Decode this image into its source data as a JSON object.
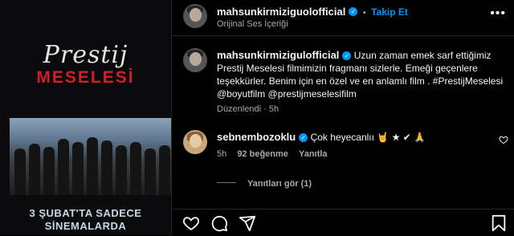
{
  "poster": {
    "title_line1": "Prestij",
    "title_line2": "MESELESİ",
    "release_line1": "3 ŞUBAT'TA SADECE",
    "release_line2": "SİNEMALARDA"
  },
  "header": {
    "username": "mahsunkirmiziguolofficial",
    "separator": "•",
    "follow_label": "Takip Et",
    "audio_label": "Orijinal Ses İçeriği",
    "more_icon": "more-horizontal-icon"
  },
  "caption": {
    "username": "mahsunkirmizigulofficial",
    "text": "Uzun zaman emek sarf ettiğimiz Prestij Meselesi filmimizin fragmanı sizlerle. Emeği geçenlere teşekkürler. Benim için en özel ve en anlamlı film . #PrestijMeselesi @boyutfilm @prestijmeselesifilm",
    "edited": "Düzenlendi",
    "separator": "·",
    "time": "5h"
  },
  "comment": {
    "username": "sebnembozoklu",
    "text": "Çok heyecanlıı 🤘 ★ ✔ 🙏",
    "time": "5h",
    "likes": "92 beğenme",
    "reply_label": "Yanıtla",
    "view_replies": "Yanıtları gör (1)"
  },
  "icons": [
    "heart-icon",
    "comment-icon",
    "share-icon",
    "bookmark-icon"
  ],
  "colors": {
    "accent": "#0095f6",
    "poster_red": "#d21f26",
    "background": "#000000"
  }
}
